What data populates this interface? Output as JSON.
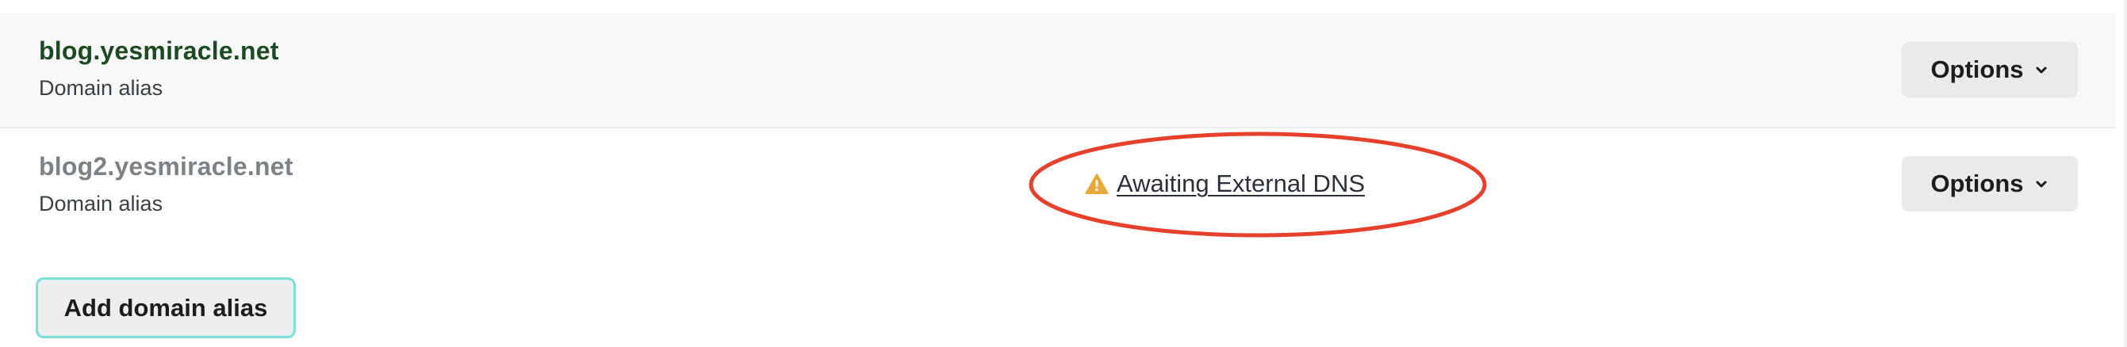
{
  "domains": [
    {
      "name": "blog.yesmiracle.net",
      "type": "Domain alias",
      "options_label": "Options"
    },
    {
      "name": "blog2.yesmiracle.net",
      "type": "Domain alias",
      "status": "Awaiting External DNS",
      "options_label": "Options"
    }
  ],
  "add_button_label": "Add domain alias",
  "colors": {
    "primary_domain_text": "#1e4a23",
    "pending_domain_text": "#7d8287",
    "warning_icon": "#e8a93b",
    "annotation_ellipse": "#e5412d",
    "focus_outline": "#7fded7"
  },
  "icons": {
    "options_chevron": "chevron-down-icon",
    "status_icon": "warning-icon"
  }
}
